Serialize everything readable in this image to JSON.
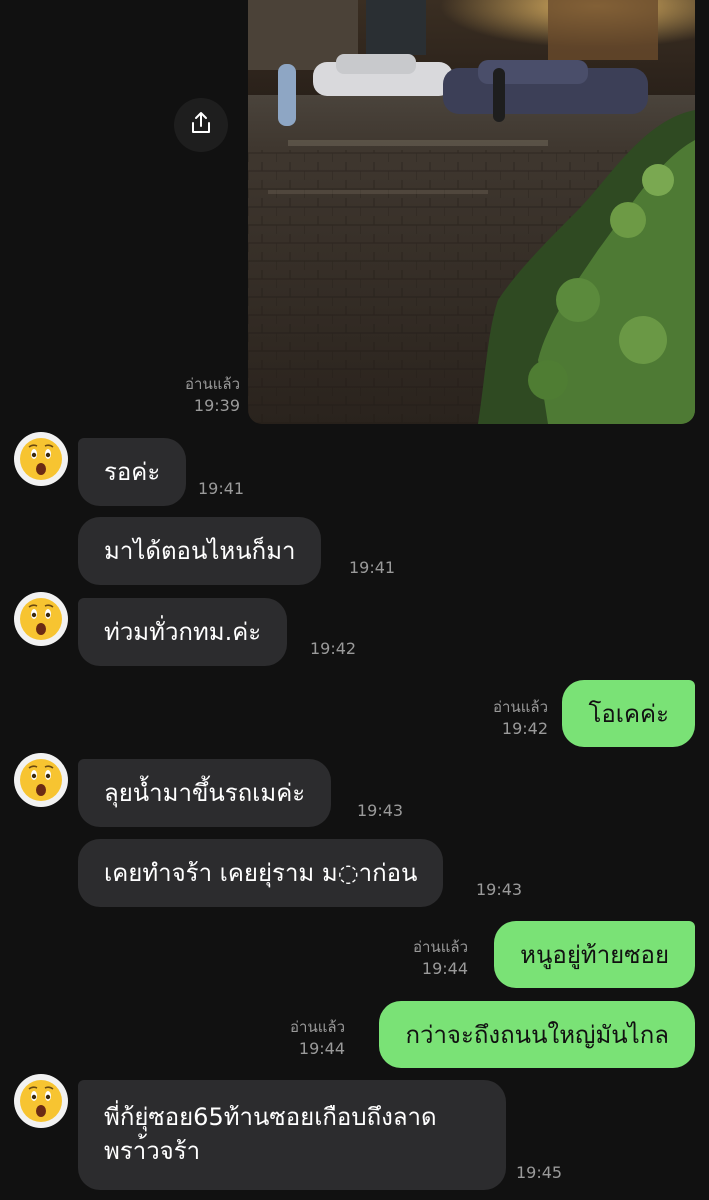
{
  "colors": {
    "background": "#111111",
    "incoming_bubble": "#2c2c2e",
    "outgoing_bubble": "#7ae276",
    "meta_text": "#9a9a9a"
  },
  "photo_message": {
    "read_label": "อ่านแล้ว",
    "time": "19:39",
    "share_icon": "share-upload-icon",
    "photo": "flooded-street-night"
  },
  "messages": [
    {
      "direction": "in",
      "text": "รอค่ะ",
      "time": "19:41",
      "avatar_icon": "astonished-face-icon"
    },
    {
      "direction": "in",
      "text": "มาได้ตอนไหนก็มา",
      "time": "19:41"
    },
    {
      "direction": "in",
      "text": "ท่วมทั่วกทม.ค่ะ",
      "time": "19:42",
      "avatar_icon": "astonished-face-icon"
    },
    {
      "direction": "out",
      "text": "โอเคค่ะ",
      "time": "19:42",
      "read_label": "อ่านแล้ว"
    },
    {
      "direction": "in",
      "text": "ลุยน้ำมาขึ้นรถเมค่ะ",
      "time": "19:43",
      "avatar_icon": "astonished-face-icon"
    },
    {
      "direction": "in",
      "text": "เคยทำจร้า เคยยุ่ราม ม◌าก่อน",
      "time": "19:43"
    },
    {
      "direction": "out",
      "text": "หนูอยู่ท้ายซอย",
      "time": "19:44",
      "read_label": "อ่านแล้ว"
    },
    {
      "direction": "out",
      "text": "กว่าจะถึงถนนใหญ่มันไกล",
      "time": "19:44",
      "read_label": "อ่านแล้ว"
    },
    {
      "direction": "in",
      "text_line1": "พี่ก้ยุ่ซอย65ท้านซอยเกือบถึงลาด",
      "text_line2": "พรา้วจร้า",
      "time": "19:45",
      "avatar_icon": "astonished-face-icon"
    }
  ]
}
